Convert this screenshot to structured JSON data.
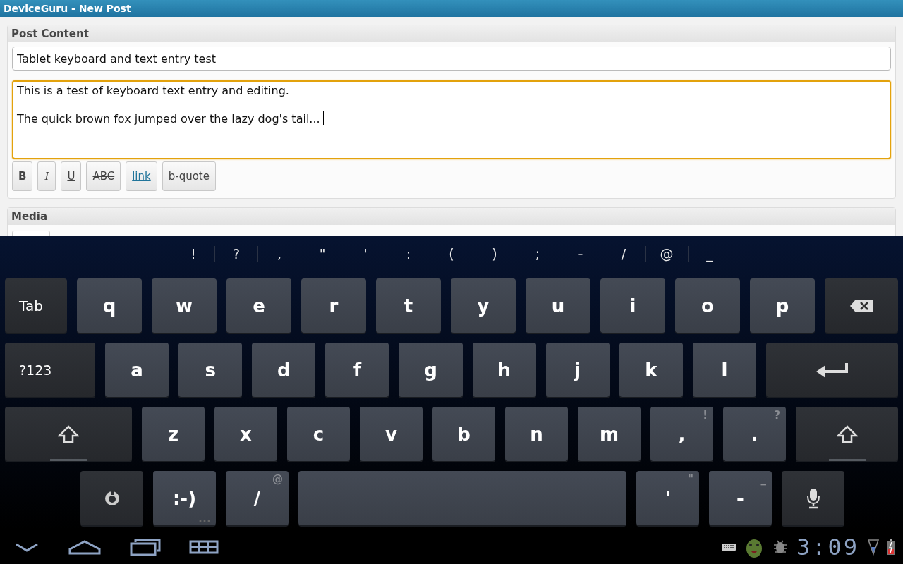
{
  "window": {
    "title": "DeviceGuru - New Post"
  },
  "post_content": {
    "heading": "Post Content",
    "title_field": {
      "value": "Tablet keyboard and text entry test"
    },
    "body_field": {
      "focused": true,
      "paragraphs": [
        "This is a test of keyboard text entry and editing.",
        "The quick brown fox jumped over the lazy dog's tail..."
      ]
    },
    "format_buttons": [
      {
        "kind": "bold",
        "label": "B"
      },
      {
        "kind": "italic",
        "label": "I"
      },
      {
        "kind": "underline",
        "label": "U"
      },
      {
        "kind": "strike",
        "label": "ABC"
      },
      {
        "kind": "link",
        "label": "link"
      },
      {
        "kind": "plain",
        "label": "b-quote"
      }
    ]
  },
  "media": {
    "heading": "Media"
  },
  "keyboard": {
    "symbols": [
      "!",
      "?",
      ",",
      "\"",
      "'",
      ":",
      "(",
      ")",
      ";",
      "-",
      "/",
      "@",
      "_"
    ],
    "rows": [
      [
        {
          "kind": "tab",
          "label": "Tab"
        },
        {
          "kind": "letter",
          "label": "q"
        },
        {
          "kind": "letter",
          "label": "w"
        },
        {
          "kind": "letter",
          "label": "e"
        },
        {
          "kind": "letter",
          "label": "r"
        },
        {
          "kind": "letter",
          "label": "t"
        },
        {
          "kind": "letter",
          "label": "y"
        },
        {
          "kind": "letter",
          "label": "u"
        },
        {
          "kind": "letter",
          "label": "i"
        },
        {
          "kind": "letter",
          "label": "o"
        },
        {
          "kind": "letter",
          "label": "p"
        },
        {
          "kind": "backspace"
        }
      ],
      [
        {
          "kind": "mode",
          "label": "?123"
        },
        {
          "kind": "letter",
          "label": "a"
        },
        {
          "kind": "letter",
          "label": "s"
        },
        {
          "kind": "letter",
          "label": "d"
        },
        {
          "kind": "letter",
          "label": "f"
        },
        {
          "kind": "letter",
          "label": "g"
        },
        {
          "kind": "letter",
          "label": "h"
        },
        {
          "kind": "letter",
          "label": "j"
        },
        {
          "kind": "letter",
          "label": "k"
        },
        {
          "kind": "letter",
          "label": "l"
        },
        {
          "kind": "enter"
        }
      ],
      [
        {
          "kind": "shift"
        },
        {
          "kind": "letter",
          "label": "z"
        },
        {
          "kind": "letter",
          "label": "x"
        },
        {
          "kind": "letter",
          "label": "c"
        },
        {
          "kind": "letter",
          "label": "v"
        },
        {
          "kind": "letter",
          "label": "b"
        },
        {
          "kind": "letter",
          "label": "n"
        },
        {
          "kind": "letter",
          "label": "m"
        },
        {
          "kind": "letter",
          "label": ",",
          "hint": "!"
        },
        {
          "kind": "letter",
          "label": ".",
          "hint": "?"
        },
        {
          "kind": "shift"
        }
      ],
      [
        {
          "kind": "settings"
        },
        {
          "kind": "letter",
          "label": ":-)",
          "more": true
        },
        {
          "kind": "letter",
          "label": "/",
          "hint": "@"
        },
        {
          "kind": "space"
        },
        {
          "kind": "letter",
          "label": "'",
          "hint": "\""
        },
        {
          "kind": "letter",
          "label": "-",
          "hint": "_"
        },
        {
          "kind": "mic"
        }
      ]
    ]
  },
  "status_bar": {
    "time": "3:09"
  }
}
